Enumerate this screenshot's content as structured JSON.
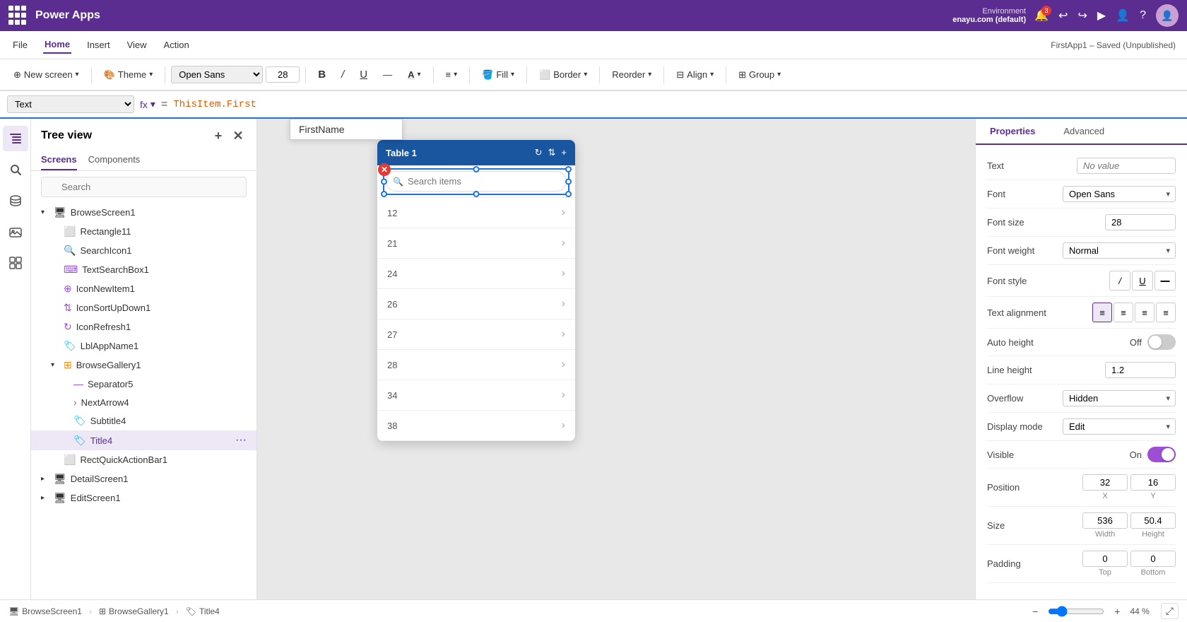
{
  "app": {
    "title": "Power Apps",
    "suite_icon": "waffle",
    "env_label": "Environment",
    "env_name": "enayu.com (default)",
    "saved_status": "FirstApp1 – Saved (Unpublished)"
  },
  "menubar": {
    "items": [
      "File",
      "Home",
      "Insert",
      "View",
      "Action"
    ],
    "active": "Home"
  },
  "toolbar": {
    "new_screen_label": "New screen",
    "theme_label": "Theme",
    "font_value": "Open Sans",
    "font_size": "28",
    "bold_label": "B",
    "italic_label": "/",
    "underline_label": "U",
    "strikethrough_label": "—",
    "font_color_label": "A",
    "align_label": "≡",
    "fill_label": "Fill",
    "border_label": "Border",
    "reorder_label": "Reorder",
    "align_r_label": "Align",
    "group_label": "Group"
  },
  "formulabar": {
    "property": "Text",
    "formula": "ThisItem.First",
    "autocomplete_text": "FirstName"
  },
  "treeview": {
    "title": "Tree view",
    "tabs": [
      "Screens",
      "Components"
    ],
    "active_tab": "Screens",
    "search_placeholder": "Search",
    "add_tooltip": "Add",
    "items": [
      {
        "id": "Rectangle11",
        "icon": "rect",
        "label": "Rectangle11",
        "indent": 1,
        "type": "shape"
      },
      {
        "id": "SearchIcon1",
        "icon": "search",
        "label": "SearchIcon1",
        "indent": 1,
        "type": "icon"
      },
      {
        "id": "TextSearchBox1",
        "icon": "input",
        "label": "TextSearchBox1",
        "indent": 1,
        "type": "input"
      },
      {
        "id": "IconNewItem1",
        "icon": "icon",
        "label": "IconNewItem1",
        "indent": 1,
        "type": "icon"
      },
      {
        "id": "IconSortUpDown1",
        "icon": "icon",
        "label": "IconSortUpDown1",
        "indent": 1,
        "type": "icon"
      },
      {
        "id": "IconRefresh1",
        "icon": "icon",
        "label": "IconRefresh1",
        "indent": 1,
        "type": "icon"
      },
      {
        "id": "LblAppName1",
        "icon": "label",
        "label": "LblAppName1",
        "indent": 1,
        "type": "label"
      },
      {
        "id": "BrowseGallery1",
        "icon": "gallery",
        "label": "BrowseGallery1",
        "indent": 1,
        "type": "gallery",
        "expanded": true
      },
      {
        "id": "Separator5",
        "icon": "separator",
        "label": "Separator5",
        "indent": 2,
        "type": "shape"
      },
      {
        "id": "NextArrow4",
        "icon": "icon",
        "label": "NextArrow4",
        "indent": 2,
        "type": "icon"
      },
      {
        "id": "Subtitle4",
        "icon": "label",
        "label": "Subtitle4",
        "indent": 2,
        "type": "label"
      },
      {
        "id": "Title4",
        "icon": "label",
        "label": "Title4",
        "indent": 2,
        "type": "label",
        "selected": true,
        "more": true
      },
      {
        "id": "RectQuickActionBar1",
        "icon": "rect",
        "label": "RectQuickActionBar1",
        "indent": 1,
        "type": "shape"
      },
      {
        "id": "DetailScreen1",
        "icon": "screen",
        "label": "DetailScreen1",
        "indent": 0,
        "type": "screen",
        "collapsed": true
      },
      {
        "id": "EditScreen1",
        "icon": "screen",
        "label": "EditScreen1",
        "indent": 0,
        "type": "screen",
        "collapsed": true
      }
    ]
  },
  "canvas": {
    "phone": {
      "header_bg": "#1a56a0",
      "search_placeholder": "Search items",
      "list_items": [
        "12",
        "21",
        "24",
        "26",
        "27",
        "28",
        "34",
        "38"
      ]
    }
  },
  "properties": {
    "active_tab": "Properties",
    "tabs": [
      "Properties",
      "Advanced"
    ],
    "rows": [
      {
        "label": "Text",
        "type": "input",
        "value": "No value"
      },
      {
        "label": "Font",
        "type": "select",
        "value": "Open Sans"
      },
      {
        "label": "Font size",
        "type": "number",
        "value": "28"
      },
      {
        "label": "Font weight",
        "type": "select",
        "value": "Normal"
      },
      {
        "label": "Font style",
        "type": "font-style"
      },
      {
        "label": "Text alignment",
        "type": "align"
      },
      {
        "label": "Auto height",
        "type": "toggle",
        "toggle_label": "Off",
        "on": false
      },
      {
        "label": "Line height",
        "type": "number",
        "value": "1.2"
      },
      {
        "label": "Overflow",
        "type": "select",
        "value": "Hidden"
      },
      {
        "label": "Display mode",
        "type": "select",
        "value": "Edit"
      },
      {
        "label": "Visible",
        "type": "toggle",
        "toggle_label": "On",
        "on": true
      },
      {
        "label": "Position",
        "type": "xy",
        "x": "32",
        "y": "16"
      },
      {
        "label": "Size",
        "type": "wh",
        "w": "536",
        "h": "50.4"
      },
      {
        "label": "Padding",
        "type": "padding",
        "top": "0",
        "bottom": "0"
      }
    ]
  },
  "statusbar": {
    "breadcrumbs": [
      "BrowseScreen1",
      "BrowseGallery1",
      "Title4"
    ],
    "zoom_value": "44 %",
    "top_label": "Top",
    "bottom_label": "Bottom"
  }
}
